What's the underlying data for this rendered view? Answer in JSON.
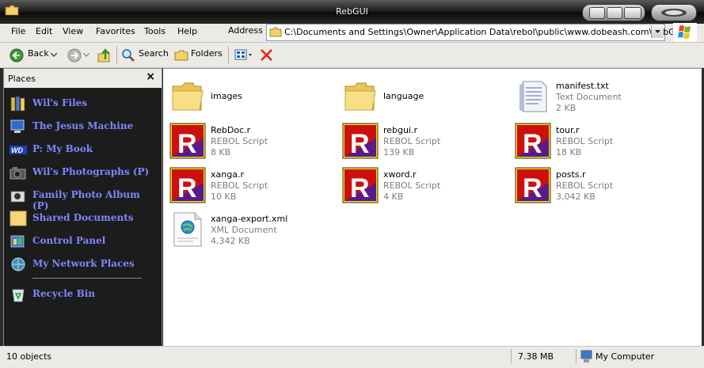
{
  "window": {
    "title": "RebGUI"
  },
  "menu": [
    "File",
    "Edit",
    "View",
    "Favorites",
    "Tools",
    "Help"
  ],
  "address": {
    "label": "Address",
    "path": "C:\\Documents and Settings\\Owner\\Application Data\\rebol\\public\\www.dobeash.com\\RebGUI"
  },
  "toolbar": {
    "back": "Back",
    "search": "Search",
    "folders": "Folders"
  },
  "places": {
    "title": "Places",
    "close": "×",
    "items": [
      {
        "label": "Wil's Files",
        "icon": "books-icon"
      },
      {
        "label": "The Jesus Machine",
        "icon": "computer-icon"
      },
      {
        "label": "P: My Book",
        "icon": "wd-drive-icon"
      },
      {
        "label": "Wil's Photographs (P)",
        "icon": "camera-icon"
      },
      {
        "label": "Family Photo Album (P)",
        "icon": "photo-camera-icon"
      },
      {
        "label": "Shared Documents",
        "icon": "folder-icon"
      },
      {
        "label": "Control Panel",
        "icon": "control-panel-icon"
      },
      {
        "label": "My Network Places",
        "icon": "network-icon"
      },
      {
        "label": "Recycle Bin",
        "icon": "recycle-bin-icon"
      }
    ]
  },
  "files": [
    {
      "name": "images",
      "type": "",
      "size": "",
      "icon": "folder-icon"
    },
    {
      "name": "language",
      "type": "",
      "size": "",
      "icon": "folder-icon"
    },
    {
      "name": "manifest.txt",
      "type": "Text Document",
      "size": "2 KB",
      "icon": "text-document-icon"
    },
    {
      "name": "RebDoc.r",
      "type": "REBOL Script",
      "size": "8 KB",
      "icon": "rebol-script-icon"
    },
    {
      "name": "rebgui.r",
      "type": "REBOL Script",
      "size": "139 KB",
      "icon": "rebol-script-icon"
    },
    {
      "name": "tour.r",
      "type": "REBOL Script",
      "size": "18 KB",
      "icon": "rebol-script-icon"
    },
    {
      "name": "xanga.r",
      "type": "REBOL Script",
      "size": "10 KB",
      "icon": "rebol-script-icon"
    },
    {
      "name": "xword.r",
      "type": "REBOL Script",
      "size": "4 KB",
      "icon": "rebol-script-icon"
    },
    {
      "name": "posts.r",
      "type": "REBOL Script",
      "size": "3,042 KB",
      "icon": "rebol-script-icon"
    },
    {
      "name": "xanga-export.xml",
      "type": "XML Document",
      "size": "4,342 KB",
      "icon": "xml-document-icon"
    }
  ],
  "status": {
    "objects": "10 objects",
    "size": "7.38 MB",
    "location": "My Computer"
  },
  "colors": {
    "places_text": "#7f86ff",
    "places_bg": "#1c1c1c",
    "rebol_red": "#cc1010",
    "rebol_purple": "#5a1a8a"
  }
}
